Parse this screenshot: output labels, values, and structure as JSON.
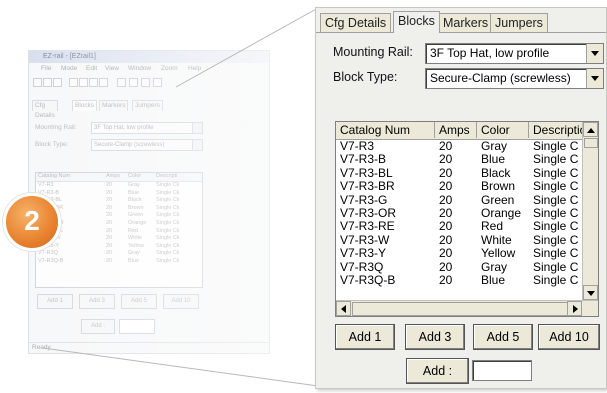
{
  "badge": {
    "number": "2"
  },
  "background_app": {
    "title": "EZ-rail - [EZrail1]",
    "menu": [
      "File",
      "Mode",
      "Edit",
      "View",
      "Window",
      "Zoom",
      "Help"
    ],
    "tabs": [
      "Cfg Details",
      "Blocks",
      "Markers",
      "Jumpers"
    ],
    "mounting_rail_label": "Mounting Rail:",
    "mounting_rail_value": "3F Top Hat, low profile",
    "block_type_label": "Block Type:",
    "block_type_value": "Secure-Clamp (screwless)",
    "columns": [
      "Catalog Num",
      "Amps",
      "Color",
      "Descripti"
    ],
    "rows": [
      [
        "V7-R3",
        "20",
        "Gray",
        "Single Ck"
      ],
      [
        "V7-R3-B",
        "20",
        "Blue",
        "Single Ck"
      ],
      [
        "V7-R3-BL",
        "20",
        "Black",
        "Single Ck"
      ],
      [
        "V7-R3-BR",
        "20",
        "Brown",
        "Single Ck"
      ],
      [
        "V7-R3-G",
        "20",
        "Green",
        "Single Ck"
      ],
      [
        "V7-R3-OR",
        "20",
        "Orange",
        "Single Ck"
      ],
      [
        "V7-R3-RE",
        "20",
        "Red",
        "Single Ck"
      ],
      [
        "V7-R3-W",
        "20",
        "White",
        "Single Ck"
      ],
      [
        "V7-R3-Y",
        "20",
        "Yellow",
        "Single Ck"
      ],
      [
        "V7-R3Q",
        "20",
        "Gray",
        "Single Ck"
      ],
      [
        "V7-R3Q-B",
        "20",
        "Blue",
        "Single Ck"
      ]
    ],
    "buttons": [
      "Add 1",
      "Add 3",
      "Add 5",
      "Add 10"
    ],
    "add_label": "Add :",
    "status": "Ready"
  },
  "zoom_panel": {
    "tabs": [
      "Cfg Details",
      "Blocks",
      "Markers",
      "Jumpers"
    ],
    "active_tab": "Blocks",
    "mounting_rail_label": "Mounting Rail:",
    "mounting_rail_value": "3F Top Hat, low profile",
    "block_type_label": "Block Type:",
    "block_type_value": "Secure-Clamp (screwless)",
    "columns": [
      "Catalog Num",
      "Amps",
      "Color",
      "Descriptio"
    ],
    "rows": [
      [
        "V7-R3",
        "20",
        "Gray",
        "Single Ck"
      ],
      [
        "V7-R3-B",
        "20",
        "Blue",
        "Single Ck"
      ],
      [
        "V7-R3-BL",
        "20",
        "Black",
        "Single Ck"
      ],
      [
        "V7-R3-BR",
        "20",
        "Brown",
        "Single Ck"
      ],
      [
        "V7-R3-G",
        "20",
        "Green",
        "Single Ck"
      ],
      [
        "V7-R3-OR",
        "20",
        "Orange",
        "Single Ck"
      ],
      [
        "V7-R3-RE",
        "20",
        "Red",
        "Single Ck"
      ],
      [
        "V7-R3-W",
        "20",
        "White",
        "Single Ck"
      ],
      [
        "V7-R3-Y",
        "20",
        "Yellow",
        "Single Ck"
      ],
      [
        "V7-R3Q",
        "20",
        "Gray",
        "Single Ck"
      ],
      [
        "V7-R3Q-B",
        "20",
        "Blue",
        "Single Ck"
      ]
    ],
    "buttons": [
      "Add 1",
      "Add 3",
      "Add 5",
      "Add 10"
    ],
    "add_label": "Add :",
    "add_value": ""
  },
  "colors": {
    "badge": "#e8812e",
    "panel": "#efefeb",
    "button_face": "#ece9d8"
  }
}
